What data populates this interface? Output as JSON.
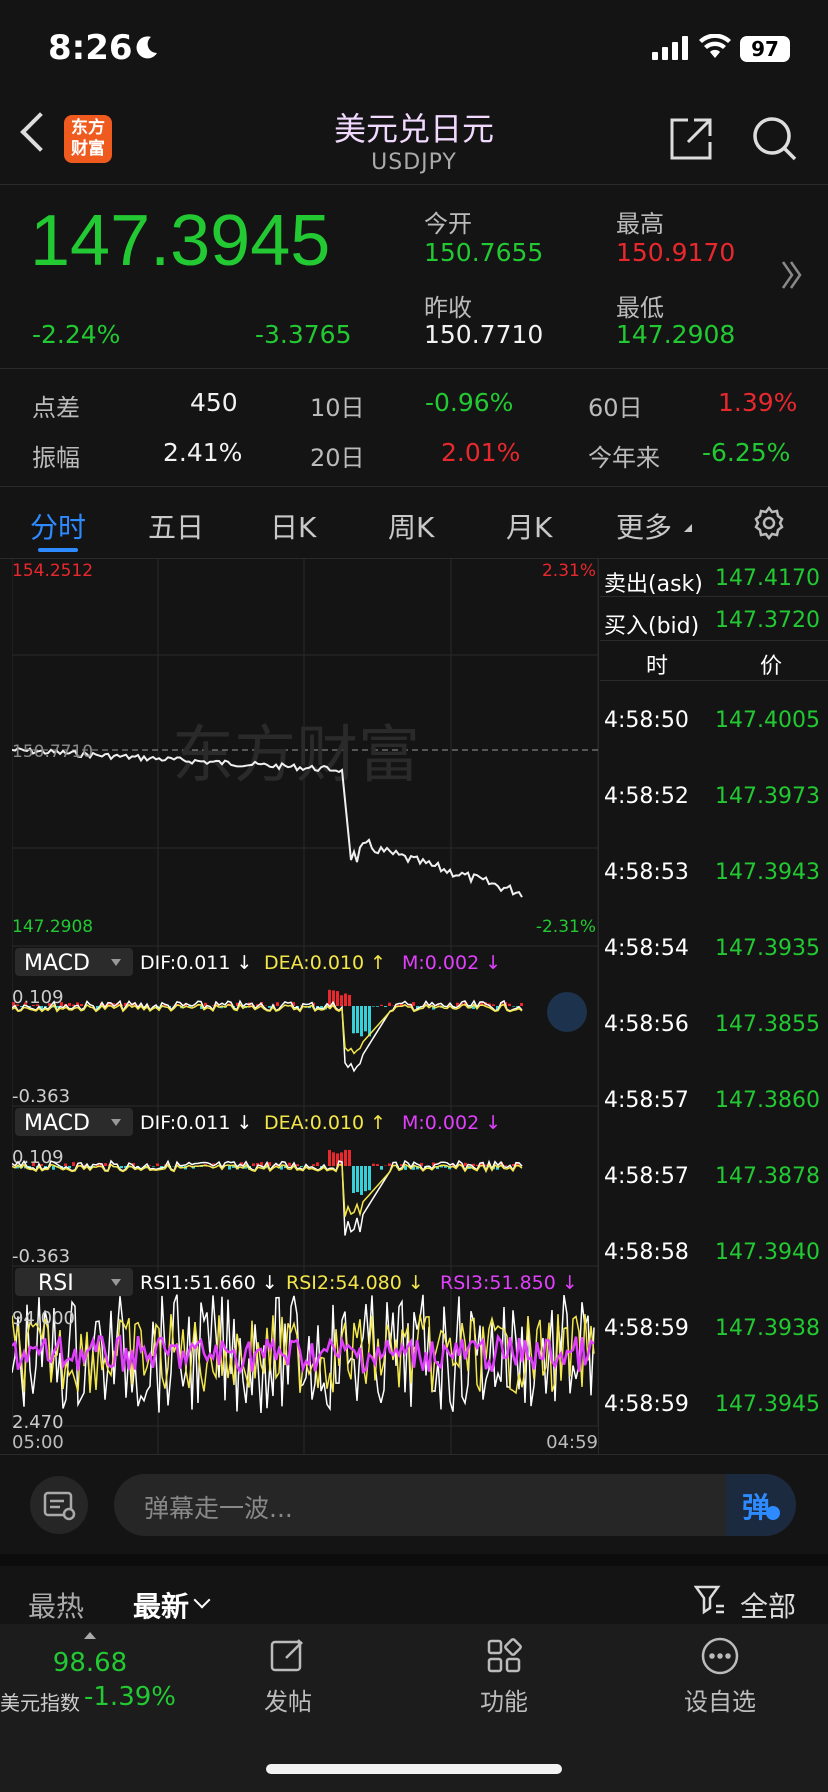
{
  "status_bar": {
    "time": "8:26",
    "battery": "97"
  },
  "header": {
    "title": "美元兑日元",
    "subtitle": "USDJPY",
    "logo_line1": "东方",
    "logo_line2": "财富"
  },
  "quote": {
    "price": "147.3945",
    "change_pct": "-2.24%",
    "change": "-3.3765",
    "open_label": "今开",
    "open": "150.7655",
    "high_label": "最高",
    "high": "150.9170",
    "prev_close_label": "昨收",
    "prev_close": "150.7710",
    "low_label": "最低",
    "low": "147.2908"
  },
  "stats": {
    "spread_label": "点差",
    "spread": "450",
    "amplitude_label": "振幅",
    "amplitude": "2.41%",
    "d10_label": "10日",
    "d10": "-0.96%",
    "d20_label": "20日",
    "d20": "2.01%",
    "d60_label": "60日",
    "d60": "1.39%",
    "ytd_label": "今年来",
    "ytd": "-6.25%"
  },
  "tabs": [
    "分时",
    "五日",
    "日K",
    "周K",
    "月K",
    "更多"
  ],
  "chart": {
    "price_high": "154.2512",
    "price_low": "147.2908",
    "price_mid": "150.7710",
    "pct_high": "2.31%",
    "pct_low": "-2.31%",
    "watermark": "东方财富",
    "time_start": "05:00",
    "time_end": "04:59"
  },
  "indicators": {
    "macd1": {
      "name": "MACD",
      "dif": "DIF:0.011 ↓",
      "dea": "DEA:0.010 ↑",
      "m": "M:0.002 ↓",
      "top": "0.109",
      "bottom": "-0.363"
    },
    "macd2": {
      "name": "MACD",
      "dif": "DIF:0.011 ↓",
      "dea": "DEA:0.010 ↑",
      "m": "M:0.002 ↓",
      "top": "0.109",
      "bottom": "-0.363"
    },
    "rsi": {
      "name": "RSI",
      "rsi1": "RSI1:51.660 ↓",
      "rsi2": "RSI2:54.080 ↓",
      "rsi3": "RSI3:51.850 ↓",
      "top": "94.000",
      "bottom": "2.470"
    }
  },
  "ticker": {
    "ask_label": "卖出(ask)",
    "ask": "147.4170",
    "bid_label": "买入(bid)",
    "bid": "147.3720",
    "col_time": "时",
    "col_price": "价",
    "rows": [
      {
        "time": "4:58:50",
        "price": "147.4005"
      },
      {
        "time": "4:58:52",
        "price": "147.3973"
      },
      {
        "time": "4:58:53",
        "price": "147.3943"
      },
      {
        "time": "4:58:54",
        "price": "147.3935"
      },
      {
        "time": "4:58:56",
        "price": "147.3855"
      },
      {
        "time": "4:58:57",
        "price": "147.3860"
      },
      {
        "time": "4:58:57",
        "price": "147.3878"
      },
      {
        "time": "4:58:58",
        "price": "147.3940"
      },
      {
        "time": "4:58:59",
        "price": "147.3938"
      },
      {
        "time": "4:58:59",
        "price": "147.3945"
      }
    ]
  },
  "comment": {
    "placeholder": "弹幕走一波...",
    "danmu_label": "弹"
  },
  "feed": {
    "hot": "最热",
    "latest": "最新",
    "filter": "全部"
  },
  "nav": {
    "index_value": "98.68",
    "index_name": "美元指数",
    "index_change": "-1.39%",
    "post": "发帖",
    "functions": "功能",
    "watchlist": "设自选"
  },
  "colors": {
    "up": "#e8282d",
    "down": "#22c932",
    "accent": "#2e8bff",
    "dea": "#f2e64a",
    "macd_m": "#e040fb"
  }
}
